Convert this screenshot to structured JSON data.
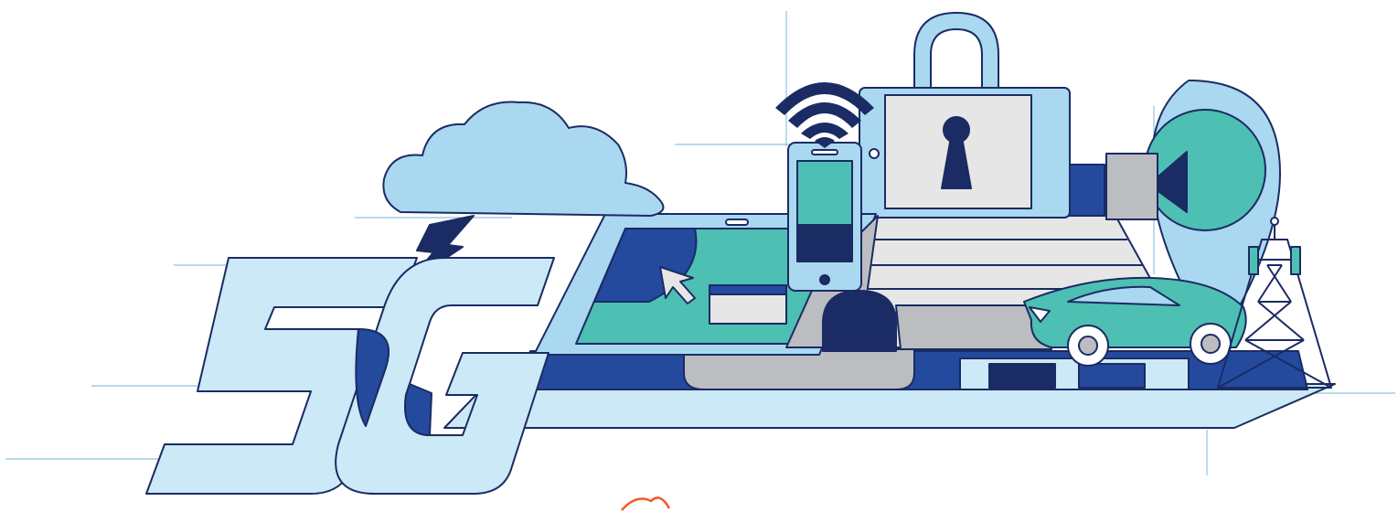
{
  "illustration": {
    "wordmark": "5G",
    "palette": {
      "navy": "#1b2b63",
      "royal": "#244a9e",
      "sky": "#a9d8f0",
      "pale": "#cbe9f6",
      "teal": "#4dbfb3",
      "grey": "#bcbdc0",
      "light_grey": "#e6e6e6",
      "accent": "#f15a24"
    },
    "elements": [
      "cloud-icon",
      "lightning-icon",
      "tablet-icon",
      "cursor-icon",
      "smartphone-icon",
      "wifi-icon",
      "padlock-icon",
      "keyhole-icon",
      "location-pin-icon",
      "camera-icon",
      "car-icon",
      "cell-tower-icon"
    ]
  }
}
